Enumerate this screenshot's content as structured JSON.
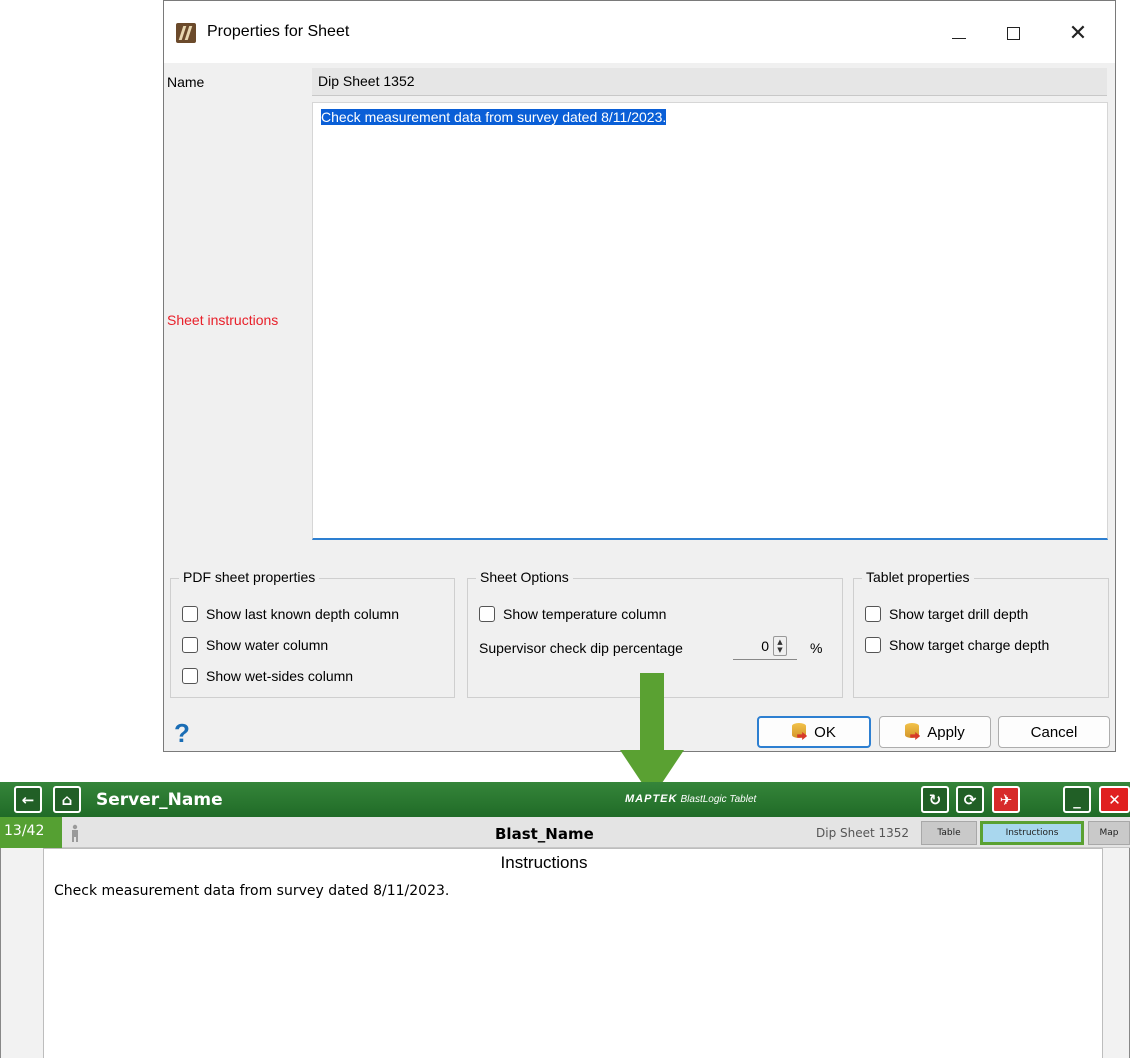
{
  "dialog": {
    "title": "Properties for Sheet",
    "name_label": "Name",
    "name_value": "Dip Sheet 1352",
    "instructions_label": "Sheet instructions",
    "instructions_value": "Check measurement data from survey dated 8/11/2023.",
    "pdf_group": {
      "title": "PDF sheet properties",
      "options": [
        "Show last known depth column",
        "Show water column",
        "Show wet-sides column"
      ]
    },
    "sheet_group": {
      "title": "Sheet Options",
      "option": "Show temperature column",
      "supervisor_label": "Supervisor check dip percentage",
      "supervisor_value": "0",
      "supervisor_unit": "%"
    },
    "tablet_group": {
      "title": "Tablet properties",
      "options": [
        "Show target drill depth",
        "Show target charge depth"
      ]
    },
    "help": "?",
    "ok_label": "OK",
    "apply_label": "Apply",
    "cancel_label": "Cancel",
    "accent_color": "#2d7fd1"
  },
  "tablet": {
    "server_name": "Server_Name",
    "logo_brand": "MAPTEK",
    "logo_product": "BlastLogic Tablet",
    "counter": "13/42",
    "blast_name": "Blast_Name",
    "sheet_name": "Dip Sheet 1352",
    "tabs": [
      "Table",
      "Instructions",
      "Map"
    ],
    "active_tab": "Instructions",
    "content_title": "Instructions",
    "content_text": "Check measurement data from survey dated 8/11/2023.",
    "brand_color": "#2a7a30",
    "highlight_color": "#5aa132"
  }
}
